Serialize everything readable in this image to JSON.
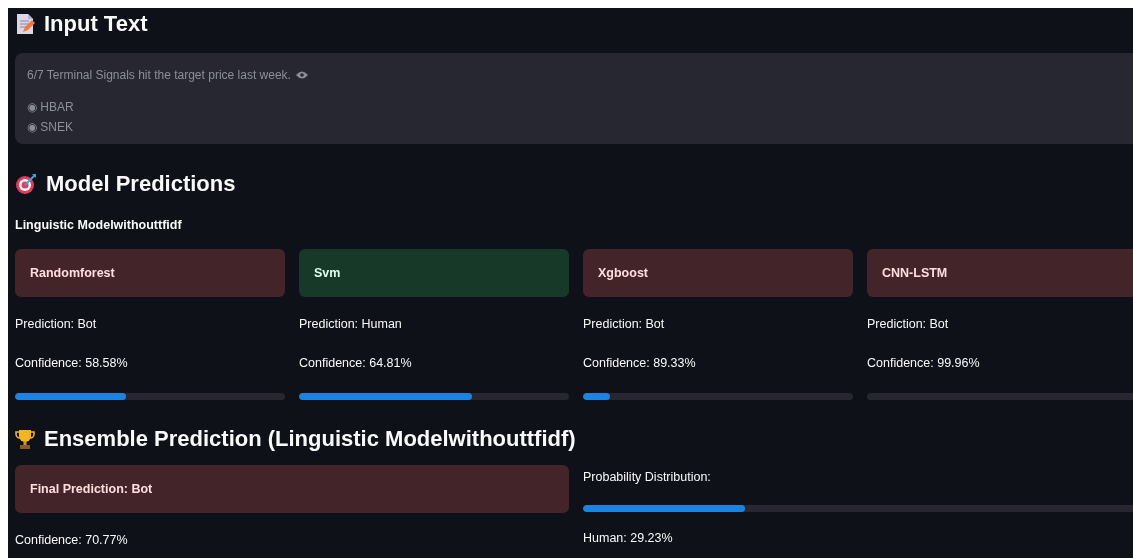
{
  "input_section": {
    "title": "Input Text",
    "text_lines": [
      "6/7 Terminal Signals hit the target price last week.",
      "◉ HBAR",
      "◉ SNEK"
    ]
  },
  "predictions_section": {
    "title": "Model Predictions",
    "subtitle": "Linguistic Modelwithouttfidf",
    "models": [
      {
        "name": "Randomforest",
        "kind": "bot",
        "prediction": "Prediction: Bot",
        "confidence": "Confidence: 58.58%",
        "level": 0.41
      },
      {
        "name": "Svm",
        "kind": "human",
        "prediction": "Prediction: Human",
        "confidence": "Confidence: 64.81%",
        "level": 0.64
      },
      {
        "name": "Xgboost",
        "kind": "bot",
        "prediction": "Prediction: Bot",
        "confidence": "Confidence: 89.33%",
        "level": 0.1
      },
      {
        "name": "CNN-LSTM",
        "kind": "bot",
        "prediction": "Prediction: Bot",
        "confidence": "Confidence: 99.96%",
        "level": 0.0
      }
    ]
  },
  "ensemble_section": {
    "title": "Ensemble Prediction (Linguistic Modelwithouttfidf)",
    "final": {
      "label": "Final Prediction: Bot",
      "kind": "bot"
    },
    "confidence": "Confidence: 70.77%",
    "distribution_label": "Probability Distribution:",
    "distribution": {
      "level": 0.29
    },
    "human_reading": "Human: 29.23%"
  }
}
